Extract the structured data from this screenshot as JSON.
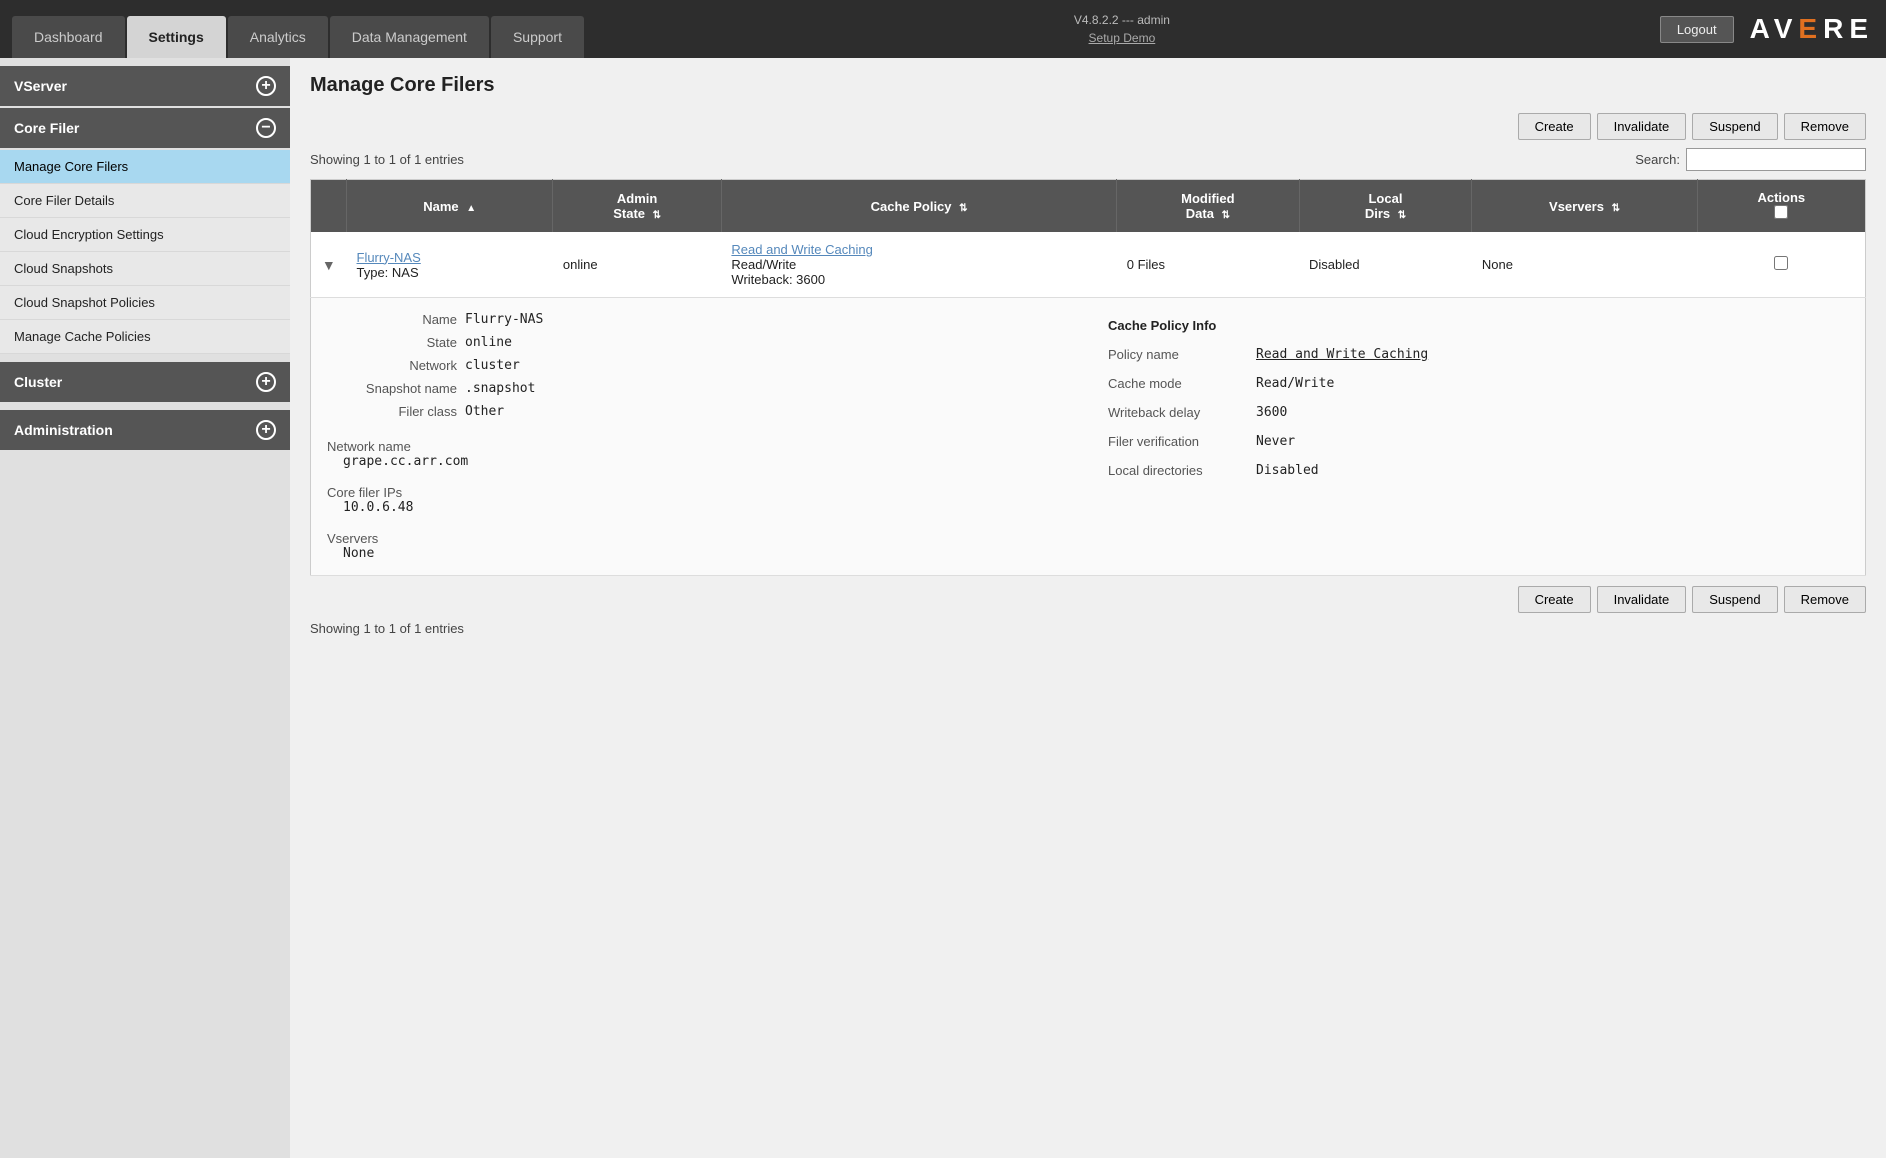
{
  "topbar": {
    "tabs": [
      {
        "label": "Dashboard",
        "active": false
      },
      {
        "label": "Settings",
        "active": true
      },
      {
        "label": "Analytics",
        "active": false
      },
      {
        "label": "Data Management",
        "active": false
      },
      {
        "label": "Support",
        "active": false
      }
    ],
    "version": "V4.8.2.2 --- admin",
    "setup": "Setup Demo",
    "logout_label": "Logout"
  },
  "logo": {
    "text_av": "AV",
    "text_e": "E",
    "text_re": "RE"
  },
  "sidebar": {
    "sections": [
      {
        "label": "VServer",
        "icon": "+",
        "collapsed": true,
        "items": []
      },
      {
        "label": "Core Filer",
        "icon": "−",
        "collapsed": false,
        "items": [
          {
            "label": "Manage Core Filers",
            "active": true
          },
          {
            "label": "Core Filer Details",
            "active": false
          },
          {
            "label": "Cloud Encryption Settings",
            "active": false
          },
          {
            "label": "Cloud Snapshots",
            "active": false
          },
          {
            "label": "Cloud Snapshot Policies",
            "active": false
          },
          {
            "label": "Manage Cache Policies",
            "active": false
          }
        ]
      },
      {
        "label": "Cluster",
        "icon": "+",
        "collapsed": true,
        "items": []
      },
      {
        "label": "Administration",
        "icon": "+",
        "collapsed": true,
        "items": []
      }
    ]
  },
  "main": {
    "title": "Manage Core Filers",
    "showing_top": "Showing 1 to 1 of 1 entries",
    "showing_bottom": "Showing 1 to 1 of 1 entries",
    "search_label": "Search:",
    "search_placeholder": "",
    "buttons": [
      "Create",
      "Invalidate",
      "Suspend",
      "Remove"
    ],
    "table": {
      "columns": [
        {
          "label": "",
          "sortable": false
        },
        {
          "label": "Name",
          "sortable": true
        },
        {
          "label": "Admin State",
          "sortable": true
        },
        {
          "label": "Cache Policy",
          "sortable": true
        },
        {
          "label": "Modified Data",
          "sortable": true
        },
        {
          "label": "Local Dirs",
          "sortable": true
        },
        {
          "label": "Vservers",
          "sortable": true
        },
        {
          "label": "Actions",
          "sortable": false,
          "checkbox": true
        }
      ],
      "rows": [
        {
          "expanded": true,
          "name": "Flurry-NAS",
          "type": "Type: NAS",
          "admin_state": "online",
          "cache_policy_link": "Read and Write Caching",
          "cache_mode": "Read/Write",
          "writeback": "Writeback: 3600",
          "modified_data": "0 Files",
          "local_dirs": "Disabled",
          "vservers": "None"
        }
      ]
    },
    "detail": {
      "name_label": "Name",
      "name_value": "Flurry-NAS",
      "state_label": "State",
      "state_value": "online",
      "network_label": "Network",
      "network_value": "cluster",
      "snapshot_label": "Snapshot name",
      "snapshot_value": ".snapshot",
      "filer_class_label": "Filer class",
      "filer_class_value": "Other",
      "network_name_label": "Network name",
      "network_name_value": "grape.cc.arr.com",
      "core_filer_ips_label": "Core filer IPs",
      "core_filer_ips_value": "10.0.6.48",
      "vservers_label": "Vservers",
      "vservers_value": "None",
      "cache_policy_section_label": "Cache Policy Info",
      "policy_name_label": "Policy name",
      "policy_name_link": "Read and Write Caching",
      "cache_mode_label": "Cache mode",
      "cache_mode_value": "Read/Write",
      "writeback_delay_label": "Writeback delay",
      "writeback_delay_value": "3600",
      "filer_verification_label": "Filer verification",
      "filer_verification_value": "Never",
      "local_directories_label": "Local directories",
      "local_directories_value": "Disabled"
    }
  }
}
